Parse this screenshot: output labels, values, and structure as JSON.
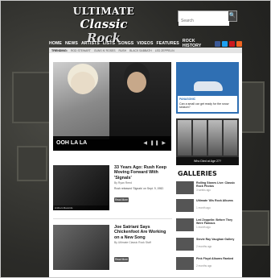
{
  "logo": {
    "line1": "ULTIMATE",
    "line2a": "Classic",
    "line2b": "Rock"
  },
  "search": {
    "placeholder": "Search",
    "button_glyph": "🔍"
  },
  "nav": {
    "items": [
      "HOME",
      "NEWS",
      "ARTISTS",
      "LISTS",
      "SONGS",
      "VIDEOS",
      "FEATURES",
      "ROCK HISTORY"
    ]
  },
  "social": {
    "icons": [
      "facebook-icon",
      "twitter-icon",
      "youtube-icon",
      "rss-icon"
    ],
    "colors": [
      "#3b5998",
      "#1da1f2",
      "#cc181e",
      "#f26522"
    ]
  },
  "subnav": {
    "lead": "TRENDING:",
    "items": [
      "ROD STEWART",
      "GUNS N' ROSES",
      "RUSH",
      "BLACK SABBATH",
      "LED ZEPPELIN"
    ]
  },
  "hero": {
    "caption": "OOH LA LA",
    "controls": "◀ ❚❚ ▶"
  },
  "ad": {
    "brand": "PANASONIC",
    "text": "Can a small car get ready for the snow season?"
  },
  "poll": {
    "question": "Who Died at Age 27?"
  },
  "galleries": {
    "title": "GALLERIES",
    "items": [
      {
        "title": "Rolling Stones Live: Classic Rock Photos",
        "date": "3 weeks ago"
      },
      {
        "title": "Ultimate '80s Rock Albums",
        "date": "1 month ago"
      },
      {
        "title": "Led Zeppelin: Before They Were Famous",
        "date": "1 month ago"
      },
      {
        "title": "Stevie Ray Vaughan Gallery",
        "date": "2 months ago"
      },
      {
        "title": "Pink Floyd Albums Ranked",
        "date": "2 months ago"
      }
    ]
  },
  "stories": [
    {
      "title": "33 Years Ago: Rush Keep Moving Forward With 'Signals'",
      "byline": "By Ryan Reed",
      "excerpt": "Rush released 'Signals' on Sept. 9, 1982.",
      "button": "Read More",
      "caption": "Anthem Records"
    },
    {
      "title": "Joe Satriani Says Chickenfoot Are Working on a New Song",
      "byline": "By Ultimate Classic Rock Staff",
      "excerpt": "",
      "button": "Read More",
      "caption": ""
    }
  ]
}
